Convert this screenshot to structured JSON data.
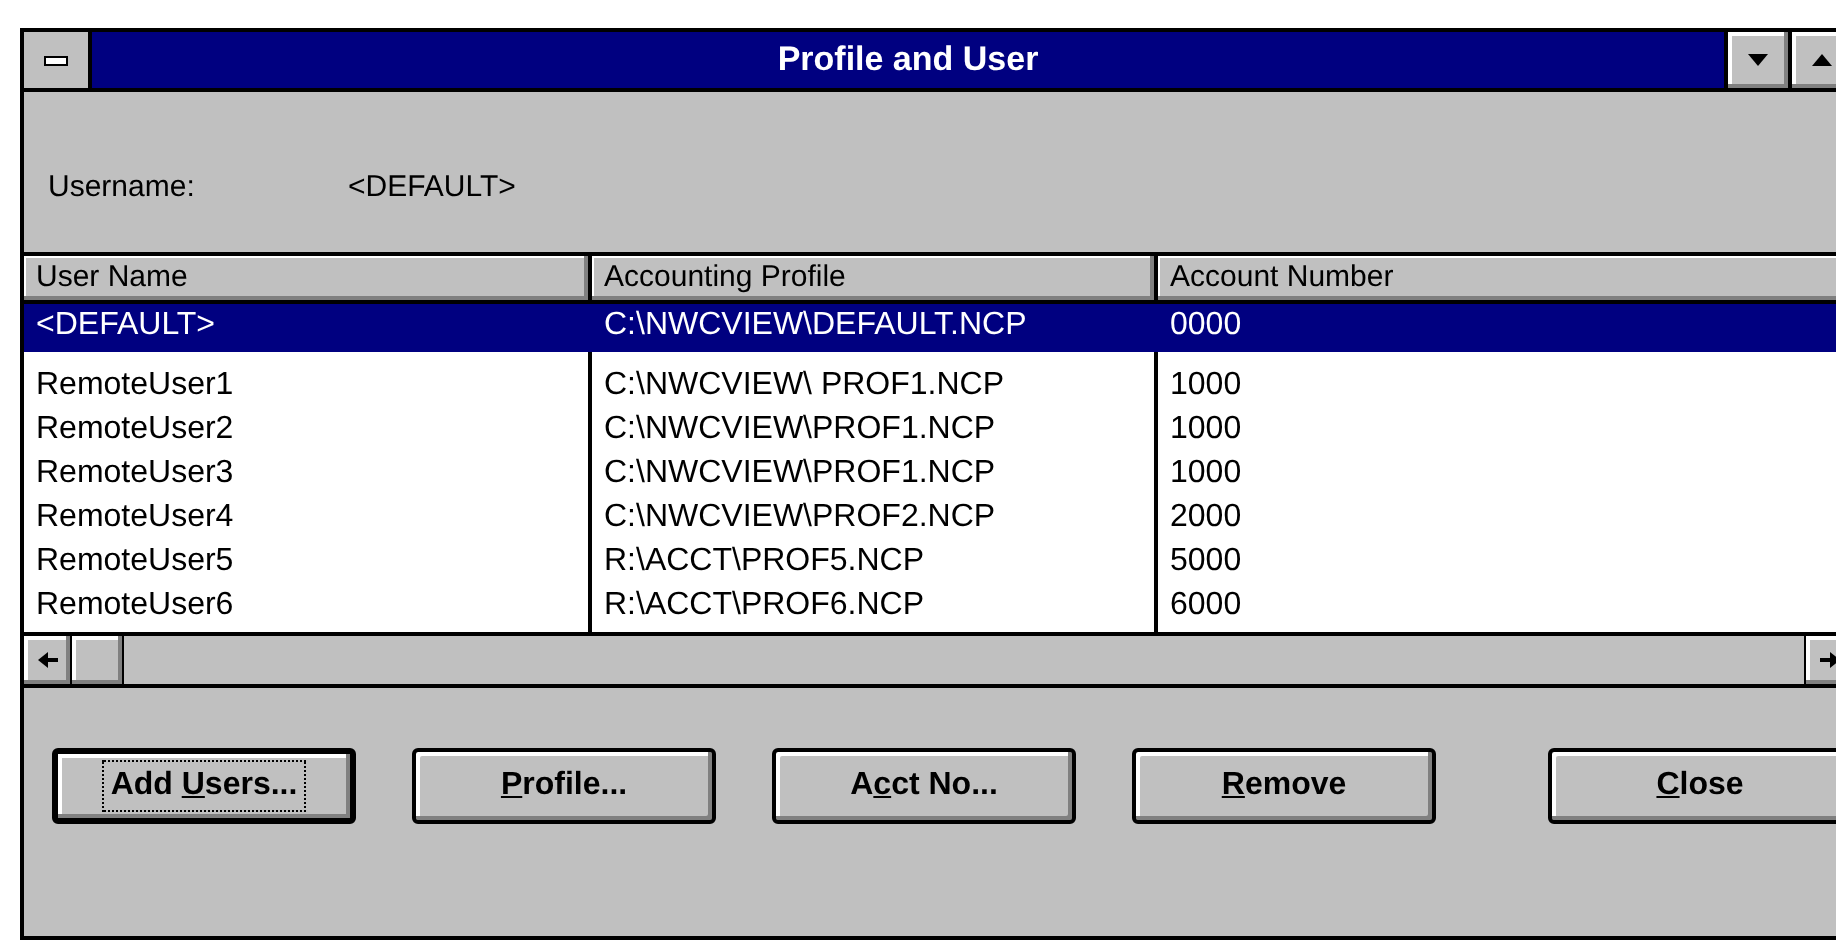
{
  "window": {
    "title": "Profile and User"
  },
  "username": {
    "label": "Username:",
    "value": "<DEFAULT>"
  },
  "table": {
    "columns": [
      "User Name",
      "Accounting Profile",
      "Account Number"
    ],
    "rows": [
      {
        "cells": [
          "<DEFAULT>",
          "C:\\NWCVIEW\\DEFAULT.NCP",
          "0000"
        ],
        "selected": true
      },
      {
        "cells": [
          "RemoteUser1",
          "C:\\NWCVIEW\\ PROF1.NCP",
          "1000"
        ],
        "selected": false
      },
      {
        "cells": [
          "RemoteUser2",
          "C:\\NWCVIEW\\PROF1.NCP",
          "1000"
        ],
        "selected": false
      },
      {
        "cells": [
          "RemoteUser3",
          "C:\\NWCVIEW\\PROF1.NCP",
          "1000"
        ],
        "selected": false
      },
      {
        "cells": [
          "RemoteUser4",
          "C:\\NWCVIEW\\PROF2.NCP",
          "2000"
        ],
        "selected": false
      },
      {
        "cells": [
          "RemoteUser5",
          "R:\\ACCT\\PROF5.NCP",
          "5000"
        ],
        "selected": false
      },
      {
        "cells": [
          "RemoteUser6",
          "R:\\ACCT\\PROF6.NCP",
          "6000"
        ],
        "selected": false
      }
    ]
  },
  "buttons": [
    {
      "before": "Add ",
      "key": "U",
      "after": "sers...",
      "default": true
    },
    {
      "key": "P",
      "after": "rofile...",
      "default": false
    },
    {
      "before": "A",
      "key": "c",
      "after": "ct No...",
      "default": false
    },
    {
      "key": "R",
      "after": "emove",
      "default": false
    },
    {
      "key": "C",
      "after": "lose",
      "default": false
    }
  ]
}
